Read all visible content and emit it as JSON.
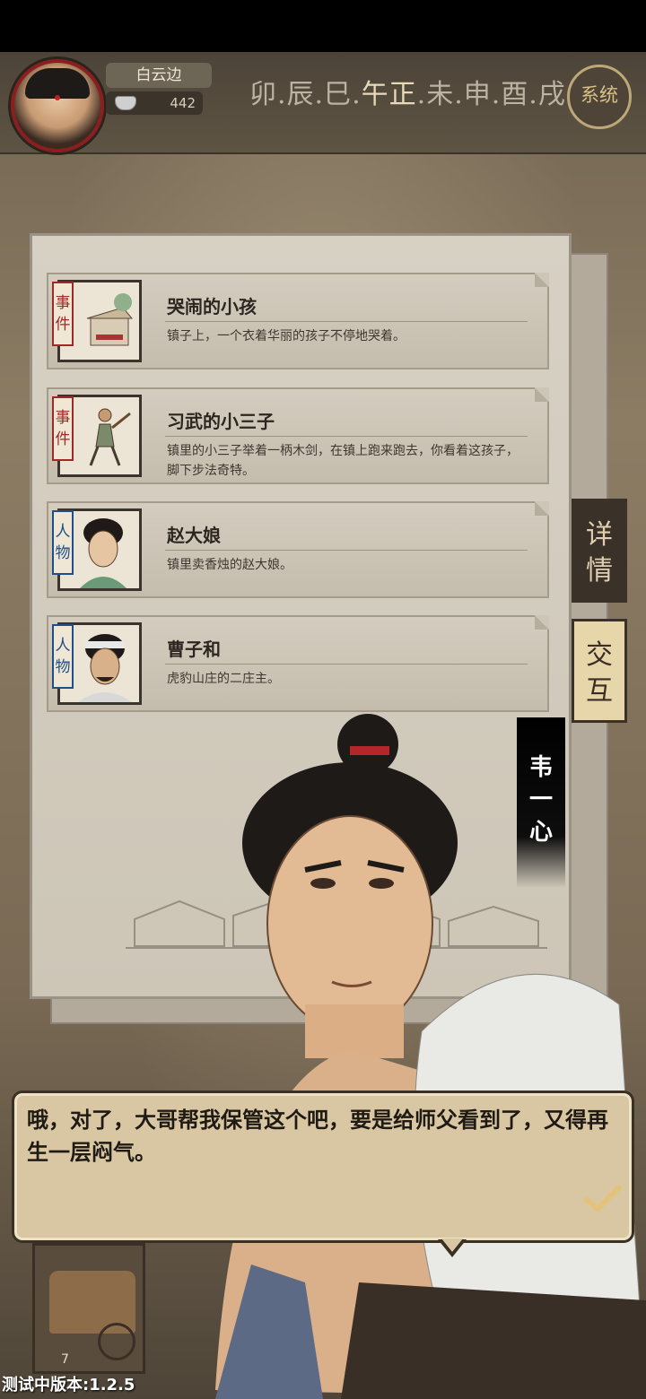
{
  "header": {
    "player_name": "白云边",
    "coins": "442",
    "time_slots": [
      "卯",
      "辰",
      "巳",
      "午",
      "正",
      "未",
      "申",
      "酉",
      "戌"
    ],
    "active_slots": [
      "午",
      "正"
    ],
    "system_label": "系统"
  },
  "cards": [
    {
      "tag": "事件",
      "type": "event",
      "title": "哭闹的小孩",
      "desc": "镇子上，一个衣着华丽的孩子不停地哭着。"
    },
    {
      "tag": "事件",
      "type": "event",
      "title": "习武的小三子",
      "desc": "镇里的小三子举着一柄木剑，在镇上跑来跑去，你看着这孩子，脚下步法奇特。"
    },
    {
      "tag": "人物",
      "type": "person",
      "title": "赵大娘",
      "desc": "镇里卖香烛的赵大娘。"
    },
    {
      "tag": "人物",
      "type": "person",
      "title": "曹子和",
      "desc": "虎豹山庄的二庄主。"
    }
  ],
  "side_tabs": {
    "detail": "详情",
    "interact": "交互"
  },
  "speaker": "韦一心",
  "dialog": {
    "text": "哦，对了，大哥帮我保管这个吧，要是给师父看到了，又得再生一层闷气。"
  },
  "bottom": {
    "count": "7"
  },
  "version": "测试中版本:1.2.5"
}
